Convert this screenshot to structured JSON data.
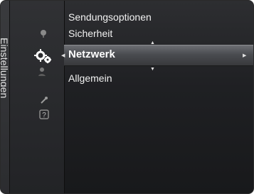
{
  "sidebar": {
    "tab_label": "Einstellungen"
  },
  "icons": [
    "mic-icon",
    "gear-icon",
    "person-icon",
    "tool-icon",
    "help-icon"
  ],
  "menu": {
    "items": [
      {
        "label": "Sendungsoptionen"
      },
      {
        "label": "Sicherheit"
      },
      {
        "label": "Netzwerk",
        "selected": true
      },
      {
        "label": "Allgemein"
      }
    ]
  },
  "colors": {
    "background": "#1f2023",
    "highlight": "#5a5c60",
    "text": "#f2f2f2"
  }
}
